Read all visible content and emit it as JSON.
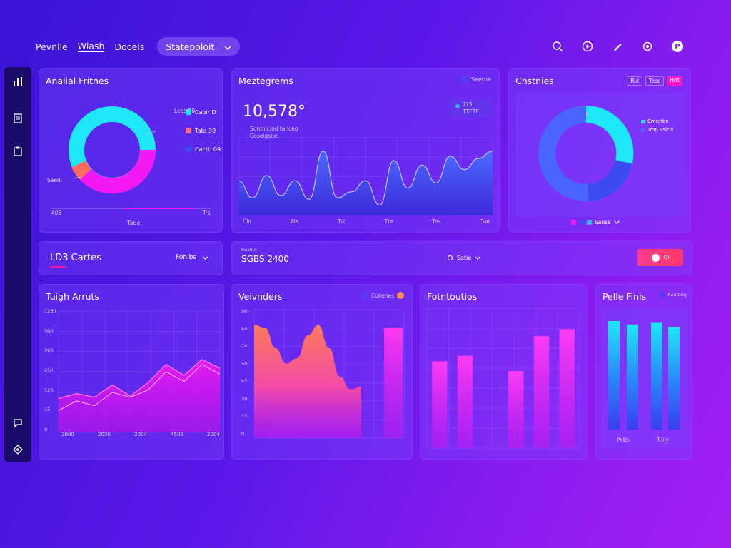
{
  "nav": {
    "items": [
      "Pevnlle",
      "Wiash",
      "Docels"
    ],
    "dropdown": "Statepoloit"
  },
  "topbar_icons": [
    "search-icon",
    "play-icon",
    "pen-icon",
    "gear-icon",
    "avatar-icon"
  ],
  "sidebar_icons": [
    "bar-chart-icon",
    "document-icon",
    "clipboard-icon",
    "chat-icon",
    "settings-icon"
  ],
  "card1": {
    "title": "Analial Fritnes",
    "legend": [
      "Caoir D",
      "Tata 39",
      "Cactti 09"
    ],
    "callout_top": "Leos 50",
    "callout_left": "Saedi",
    "axis_left": "405",
    "axis_right": "Trs",
    "xlabel": "Taqel",
    "colors": {
      "cyan": "#1ee8f8",
      "magenta": "#f418f4",
      "coral": "#ff6a5a",
      "blue": "#3a4cf0"
    }
  },
  "card2": {
    "title": "Meztegrems",
    "badge": "Seetne",
    "big_value": "10,578°",
    "sub1": "Sontniciod tancep",
    "sub2": "Coseigsoel",
    "mini": "7?S",
    "mini_sub": "TTETE",
    "xticks": [
      "Cld",
      "Ats",
      "Tsc",
      "Tte",
      "Tes",
      "Cae"
    ]
  },
  "card3": {
    "title": "Chstnies",
    "tabs": [
      "Rul",
      "Tese",
      "Hitt"
    ],
    "legend": [
      "Cmerlbn",
      "Trop Ssicls"
    ],
    "footer": "Sanse"
  },
  "row2": {
    "left_title": "LD3 Cartes",
    "left_dropdown": "Fonibs",
    "right_label": "Rasind",
    "right_value": "SGBS 2400",
    "right_select": "Satie",
    "toggle_label": "OI"
  },
  "card4": {
    "title": "Tuigh Arruts",
    "yticks": [
      "1260",
      "500",
      "360",
      "250",
      "120",
      "15",
      "0"
    ],
    "xticks": [
      "2000",
      "2020",
      "2004",
      "4505",
      "2004"
    ]
  },
  "card5": {
    "title": "Veivnders",
    "legend": "Cullenes",
    "yticks": [
      "90",
      "80",
      "74",
      "50",
      "45",
      "20",
      "15",
      "0"
    ]
  },
  "card6": {
    "title": "Fotntoutios"
  },
  "card7": {
    "title": "Pelle Finis",
    "badge": "Aaulting",
    "xticks": [
      "Potis",
      "Tuily"
    ]
  },
  "chart_data": [
    {
      "type": "pie",
      "title": "Analial Fritnes",
      "categories": [
        "Caoir D",
        "Tata 39",
        "Cactti 09"
      ],
      "values": [
        50,
        42,
        8
      ],
      "donut": true
    },
    {
      "type": "area",
      "title": "Meztegrems",
      "x": [
        "Cld",
        "Ats",
        "Tsc",
        "Tte",
        "Tes",
        "Cae"
      ],
      "series": [
        {
          "values": [
            0.45,
            0.22,
            0.52,
            0.25,
            0.45,
            0.2,
            0.85,
            0.22,
            0.3,
            0.45,
            0.12,
            0.72,
            0.35,
            0.66,
            0.42,
            0.78,
            0.6,
            0.75,
            0.85
          ]
        }
      ],
      "grid": true
    },
    {
      "type": "pie",
      "title": "Chstnies",
      "categories": [
        "Cmerlbn",
        "Trop Ssicls"
      ],
      "values": [
        72,
        28
      ],
      "donut": true
    },
    {
      "type": "area",
      "title": "Tuigh Arruts",
      "x": [
        "2000",
        "2020",
        "2004",
        "4505",
        "2004"
      ],
      "series": [
        {
          "values": [
            280,
            320,
            290,
            390,
            300,
            410,
            560,
            470,
            600,
            530
          ]
        },
        {
          "values": [
            180,
            260,
            220,
            330,
            290,
            350,
            500,
            420,
            560,
            480
          ]
        }
      ],
      "ylim": [
        0,
        1000
      ],
      "grid": true
    },
    {
      "type": "bar",
      "title": "Veivnders",
      "series": [
        {
          "name": "area",
          "values": [
            88,
            86,
            70,
            58,
            62,
            80,
            88,
            70,
            48,
            38,
            40
          ]
        },
        {
          "name": "bar",
          "values": [
            86
          ]
        }
      ],
      "ylim": [
        0,
        100
      ],
      "grid": true
    },
    {
      "type": "bar",
      "title": "Fotntoutios",
      "categories": [
        "1",
        "2",
        "3",
        "4",
        "5",
        "6"
      ],
      "values": [
        62,
        66,
        0,
        55,
        80,
        85
      ],
      "ylim": [
        0,
        100
      ],
      "grid": true
    },
    {
      "type": "bar",
      "title": "Pelle Finis",
      "categories": [
        "1",
        "2",
        "3",
        "4"
      ],
      "values": [
        95,
        92,
        94,
        90
      ],
      "ylim": [
        0,
        100
      ]
    }
  ]
}
